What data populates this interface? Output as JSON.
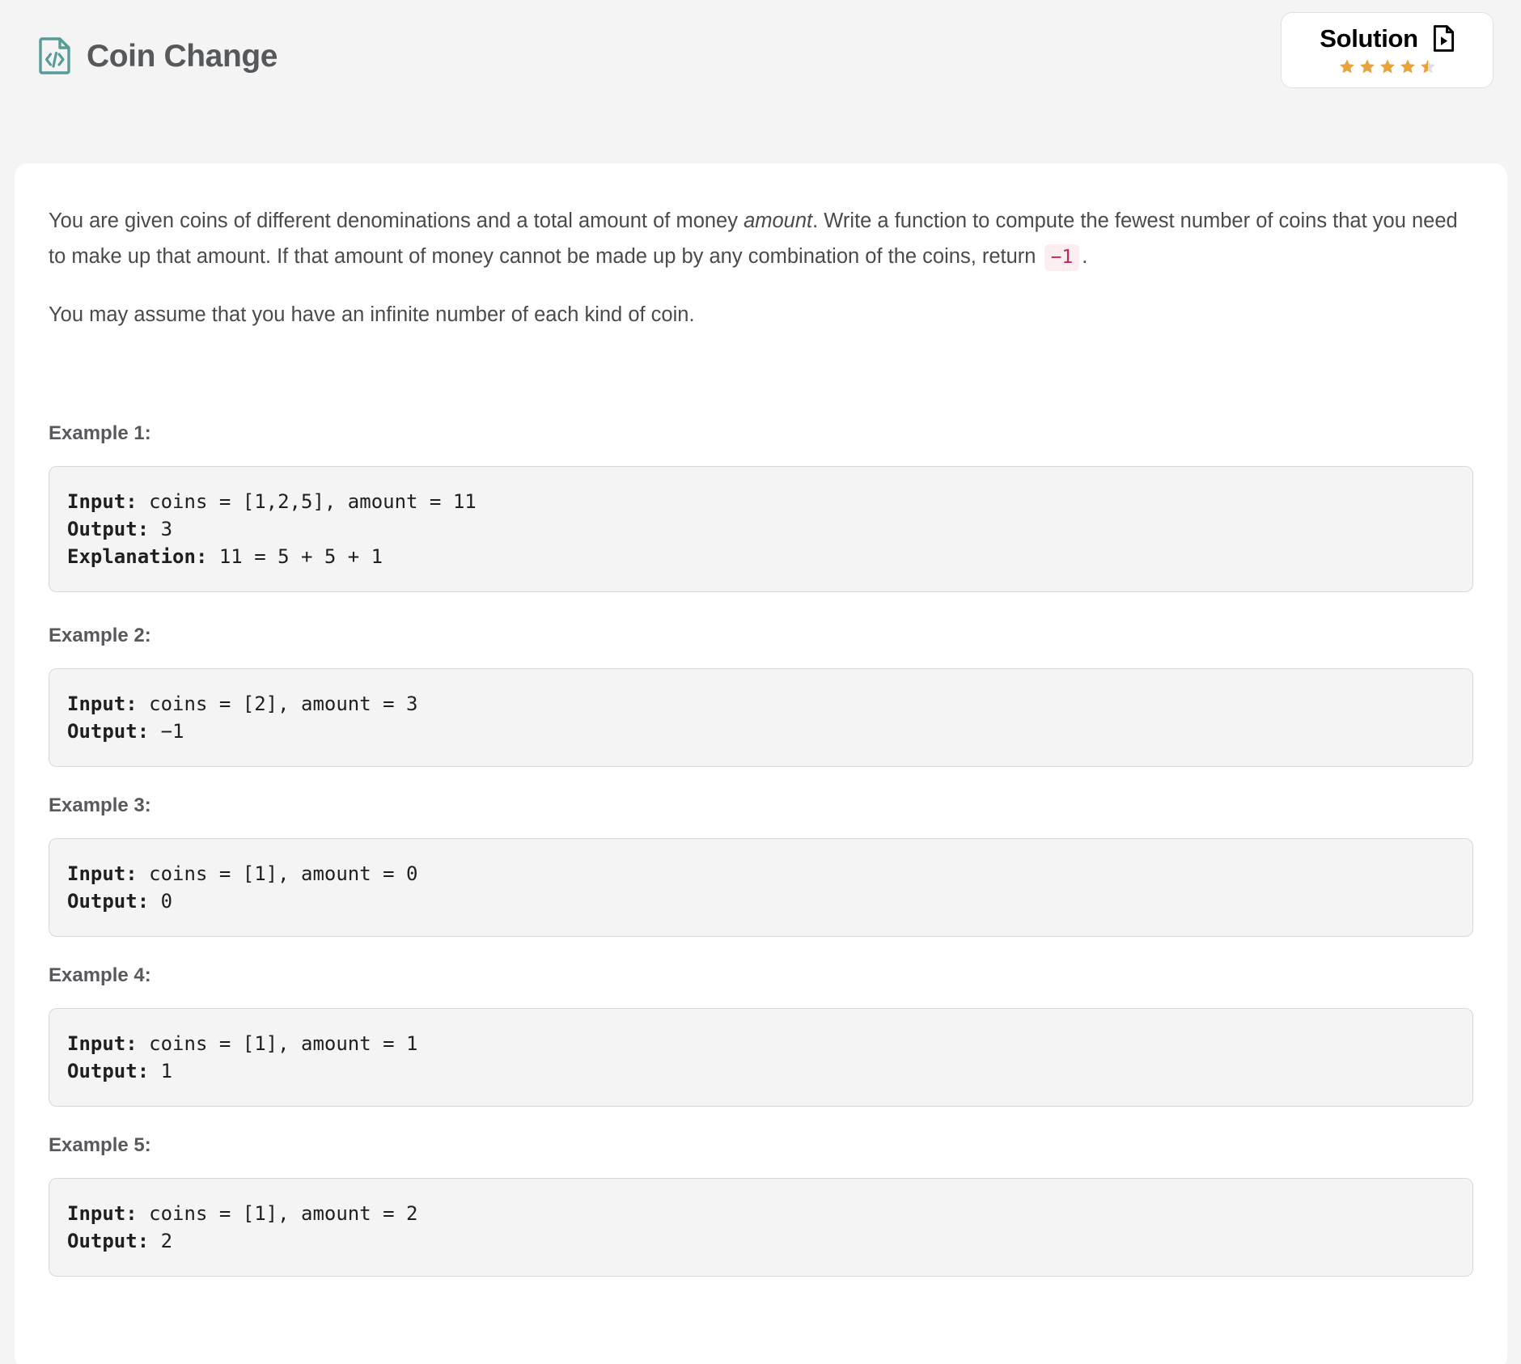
{
  "header": {
    "title": "Coin Change",
    "title_icon": "code-file-icon",
    "solution": {
      "label": "Solution",
      "icon": "document-play-icon",
      "rating": 4.5,
      "max_rating": 5,
      "star_color": "#e8a33d",
      "star_empty_color": "#dfdfdf"
    }
  },
  "colors": {
    "page_background": "#f4f4f4",
    "card_background": "#ffffff",
    "title_icon": "#5a9a97",
    "title_text": "#56595b",
    "body_text": "#4a4a4a",
    "heading_text": "#57595c",
    "inline_code_bg": "#faeef1",
    "inline_code_fg": "#c2255c",
    "code_box_bg": "#f4f4f4",
    "code_box_border": "#d8d8d8"
  },
  "description": {
    "paragraph1_part1": "You are given coins of different denominations and a total amount of money ",
    "paragraph1_emphasis": "amount",
    "paragraph1_part2": ". Write a function to compute the fewest number of coins that you need to make up that amount. If that amount of money cannot be made up by any combination of the coins, return ",
    "paragraph1_code": "−1",
    "paragraph1_part3": ".",
    "paragraph2": "You may assume that you have an infinite number of each kind of coin."
  },
  "examples": [
    {
      "heading": "Example 1:",
      "lines": [
        {
          "label": "Input:",
          "value": " coins = [1,2,5], amount = 11"
        },
        {
          "label": "Output:",
          "value": " 3"
        },
        {
          "label": "Explanation:",
          "value": " 11 = 5 + 5 + 1"
        }
      ]
    },
    {
      "heading": "Example 2:",
      "lines": [
        {
          "label": "Input:",
          "value": " coins = [2], amount = 3"
        },
        {
          "label": "Output:",
          "value": " −1"
        }
      ]
    },
    {
      "heading": "Example 3:",
      "lines": [
        {
          "label": "Input:",
          "value": " coins = [1], amount = 0"
        },
        {
          "label": "Output:",
          "value": " 0"
        }
      ]
    },
    {
      "heading": "Example 4:",
      "lines": [
        {
          "label": "Input:",
          "value": " coins = [1], amount = 1"
        },
        {
          "label": "Output:",
          "value": " 1"
        }
      ]
    },
    {
      "heading": "Example 5:",
      "lines": [
        {
          "label": "Input:",
          "value": " coins = [1], amount = 2"
        },
        {
          "label": "Output:",
          "value": " 2"
        }
      ]
    }
  ]
}
